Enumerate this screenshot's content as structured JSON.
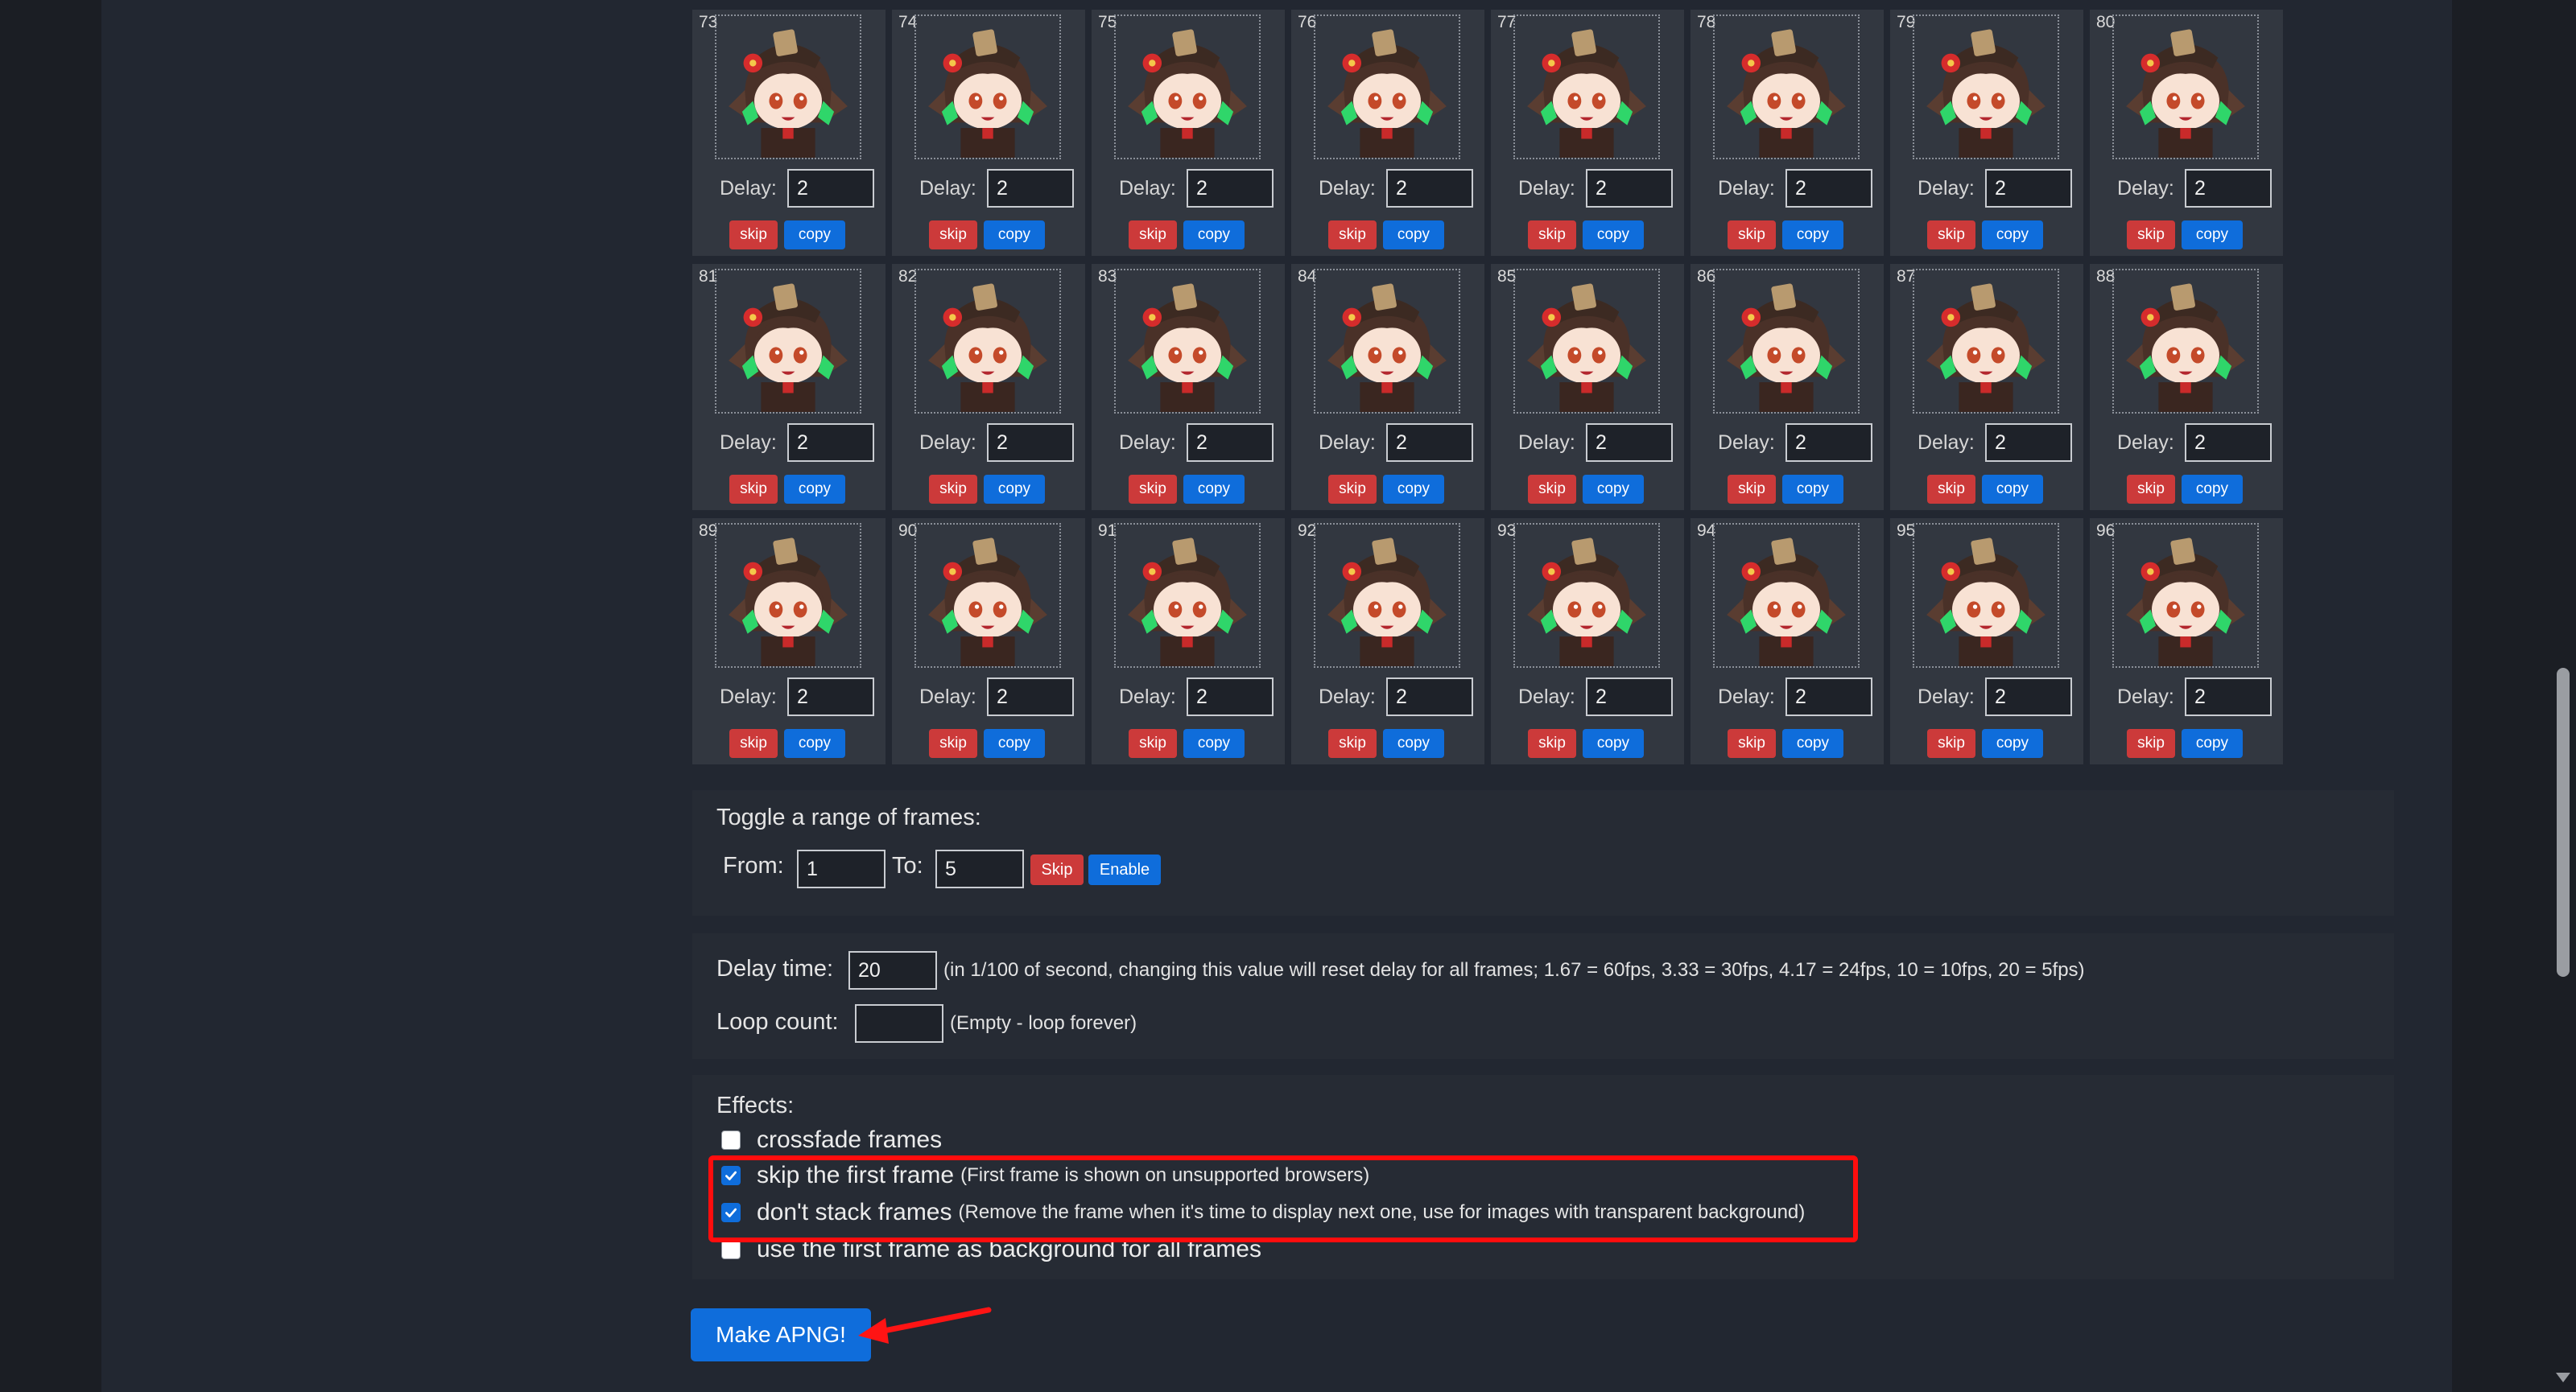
{
  "frames": {
    "delay_label": "Delay:",
    "skip_label": "skip",
    "copy_label": "copy",
    "items": [
      {
        "num": "73",
        "delay": "2"
      },
      {
        "num": "74",
        "delay": "2"
      },
      {
        "num": "75",
        "delay": "2"
      },
      {
        "num": "76",
        "delay": "2"
      },
      {
        "num": "77",
        "delay": "2"
      },
      {
        "num": "78",
        "delay": "2"
      },
      {
        "num": "79",
        "delay": "2"
      },
      {
        "num": "80",
        "delay": "2"
      },
      {
        "num": "81",
        "delay": "2"
      },
      {
        "num": "82",
        "delay": "2"
      },
      {
        "num": "83",
        "delay": "2"
      },
      {
        "num": "84",
        "delay": "2"
      },
      {
        "num": "85",
        "delay": "2"
      },
      {
        "num": "86",
        "delay": "2"
      },
      {
        "num": "87",
        "delay": "2"
      },
      {
        "num": "88",
        "delay": "2"
      },
      {
        "num": "89",
        "delay": "2"
      },
      {
        "num": "90",
        "delay": "2"
      },
      {
        "num": "91",
        "delay": "2"
      },
      {
        "num": "92",
        "delay": "2"
      },
      {
        "num": "93",
        "delay": "2"
      },
      {
        "num": "94",
        "delay": "2"
      },
      {
        "num": "95",
        "delay": "2"
      },
      {
        "num": "96",
        "delay": "2"
      }
    ]
  },
  "toggle_range": {
    "title": "Toggle a range of frames:",
    "from_label": "From:",
    "from_value": "1",
    "to_label": "To:",
    "to_value": "5",
    "skip_label": "Skip",
    "enable_label": "Enable"
  },
  "timing": {
    "delay_label": "Delay time:",
    "delay_value": "20",
    "delay_hint": "(in 1/100 of second, changing this value will reset delay for all frames; 1.67 = 60fps, 3.33 = 30fps, 4.17 = 24fps, 10 = 10fps, 20 = 5fps)",
    "loop_label": "Loop count:",
    "loop_value": "",
    "loop_hint": "(Empty - loop forever)"
  },
  "effects": {
    "title": "Effects:",
    "crossfade_label": "crossfade frames",
    "crossfade_checked": false,
    "skip_first_label": "skip the first frame",
    "skip_first_note": "(First frame is shown on unsupported browsers)",
    "skip_first_checked": true,
    "no_stack_label": "don't stack frames",
    "no_stack_note": "(Remove the frame when it's time to display next one, use for images with transparent background)",
    "no_stack_checked": true,
    "bg_first_label": "use the first frame as background for all frames",
    "bg_first_checked": false
  },
  "make_button_label": "Make APNG!",
  "colors": {
    "skip_red": "#cc3a3a",
    "primary_blue": "#0f6ddb",
    "highlight_red": "#ff0d0d",
    "card_bg": "#323740"
  }
}
